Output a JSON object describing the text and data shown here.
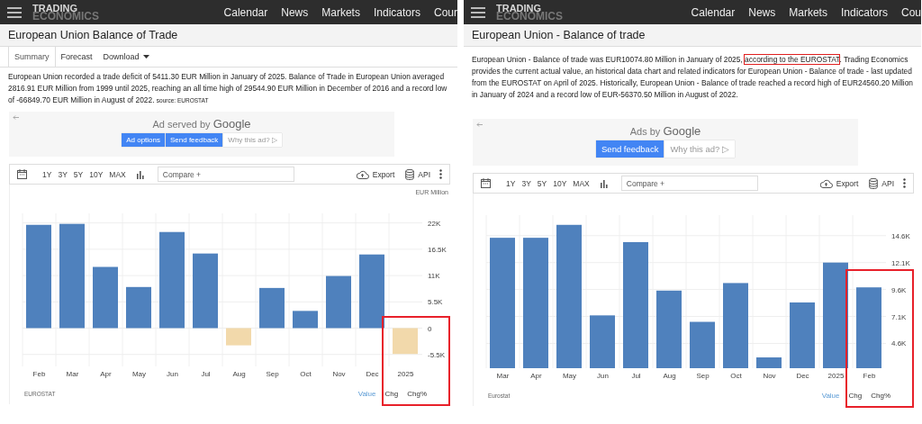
{
  "panels": [
    {
      "nav": {
        "logo_top": "TRADING",
        "logo_bottom": "ECONOMICS",
        "links": [
          "Calendar",
          "News",
          "Markets",
          "Indicators",
          "Cour"
        ]
      },
      "title": "European Union Balance of Trade",
      "tabs": [
        {
          "label": "Summary",
          "selected": true,
          "dropdown": false
        },
        {
          "label": "Forecast",
          "selected": false,
          "dropdown": false
        },
        {
          "label": "Download",
          "selected": false,
          "dropdown": true
        }
      ],
      "description": {
        "text": "European Union recorded a trade deficit of 5411.30 EUR Million in January of 2025. Balance of Trade in European Union averaged 2816.91 EUR Million from 1999 until 2025, reaching an all time high of 29544.90 EUR Million in December of 2016 and a record low of -66849.70 EUR Million in August of 2022.",
        "source": "source: EUROSTAT"
      },
      "ad": {
        "heading": "Ad served by **Google**",
        "buttons": [
          {
            "label": "Ad options",
            "kind": "primary"
          },
          {
            "label": "Send feedback",
            "kind": "primary"
          },
          {
            "label": "Why this ad? ▷",
            "kind": "plain"
          }
        ]
      },
      "toolbar": {
        "ranges": [
          "1Y",
          "3Y",
          "5Y",
          "10Y",
          "MAX"
        ],
        "compare_placeholder": "Compare +",
        "export": "Export",
        "api": "API"
      },
      "unit": "EUR Million",
      "chart_data": {
        "type": "bar",
        "categories": [
          "Feb",
          "Mar",
          "Apr",
          "May",
          "Jun",
          "Jul",
          "Aug",
          "Sep",
          "Oct",
          "Nov",
          "Dec",
          "2025"
        ],
        "grid": true,
        "series": [
          {
            "color": "#4f81bd",
            "values": [
              21.6,
              21.8,
              12.8,
              8.6,
              20.1,
              15.6,
              null,
              8.4,
              3.6,
              10.9,
              15.4,
              null
            ]
          },
          {
            "color": "#f2d9ab",
            "values": [
              null,
              null,
              null,
              null,
              null,
              null,
              -3.6,
              null,
              null,
              null,
              null,
              -5.4
            ]
          }
        ],
        "ylim": [
          -8,
          24
        ],
        "yticks": [
          {
            "value": 22,
            "label": "22K"
          },
          {
            "value": 16.5,
            "label": "16.5K"
          },
          {
            "value": 11,
            "label": "11K"
          },
          {
            "value": 5.5,
            "label": "5.5K"
          },
          {
            "value": 0,
            "label": "0"
          },
          {
            "value": -5.5,
            "label": "-5.5K"
          }
        ]
      },
      "source": "EUROSTAT",
      "modes": [
        {
          "label": "Value",
          "selected": true
        },
        {
          "label": "Chg",
          "selected": false
        },
        {
          "label": "Chg%",
          "selected": false
        }
      ],
      "highlighted": true
    },
    {
      "nav": {
        "logo_top": "TRADING",
        "logo_bottom": "ECONOMICS",
        "links": [
          "Calendar",
          "News",
          "Markets",
          "Indicators",
          "Cou"
        ]
      },
      "title": "European Union - Balance of trade",
      "description": {
        "before": "European Union - Balance of trade was EUR10074.80 Million in January of 2025, ",
        "marked": "according to the EUROSTAT",
        "after": ". Trading Economics provides the current actual value, an historical data chart and related indicators for European Union - Balance of trade - last updated from the EUROSTAT on April of 2025. Historically, European Union - Balance of trade reached a record high of EUR24560.20 Million in January of 2024 and a record low of EUR-56370.50 Million in August of 2022."
      },
      "ad": {
        "heading": "Ads by **Google**",
        "buttons": [
          {
            "label": "Send feedback",
            "kind": "primary"
          },
          {
            "label": "Why this ad? ▷",
            "kind": "plain"
          }
        ]
      },
      "toolbar": {
        "ranges": [
          "1Y",
          "3Y",
          "5Y",
          "10Y",
          "MAX"
        ],
        "compare_placeholder": "Compare +",
        "export": "Export",
        "api": "API"
      },
      "chart_data": {
        "type": "bar",
        "categories": [
          "Mar",
          "Apr",
          "May",
          "Jun",
          "Jul",
          "Aug",
          "Sep",
          "Oct",
          "Nov",
          "Dec",
          "2025",
          "Feb"
        ],
        "grid": true,
        "series": [
          {
            "color": "#4f81bd",
            "values": [
              14.4,
              14.4,
              15.6,
              7.2,
              14.0,
              9.5,
              6.6,
              10.2,
              3.3,
              8.4,
              12.1,
              9.8
            ]
          }
        ],
        "ylim": [
          2.3,
          16.5
        ],
        "yticks": [
          {
            "value": 14.6,
            "label": "14.6K"
          },
          {
            "value": 12.1,
            "label": "12.1K"
          },
          {
            "value": 9.6,
            "label": "9.6K"
          },
          {
            "value": 7.1,
            "label": "7.1K"
          },
          {
            "value": 4.6,
            "label": "4.6K"
          }
        ]
      },
      "source": "Eurostat",
      "modes": [
        {
          "label": "Value",
          "selected": true
        },
        {
          "label": "Chg",
          "selected": false
        },
        {
          "label": "Chg%",
          "selected": false
        }
      ],
      "highlighted": true
    }
  ]
}
